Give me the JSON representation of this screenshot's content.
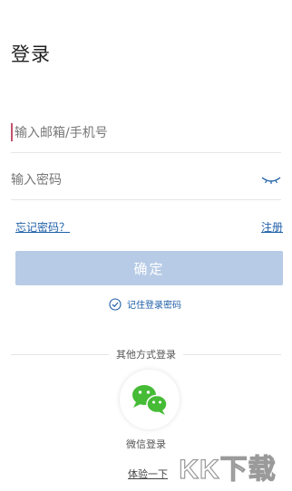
{
  "header": {
    "title": "登录"
  },
  "form": {
    "account_placeholder": "输入邮箱/手机号",
    "account_value": "",
    "password_placeholder": "输入密码",
    "password_value": "",
    "forgot_password": "忘记密码？",
    "register": "注册",
    "confirm": "确定",
    "remember_password": "记住登录密码"
  },
  "other_login": {
    "divider_text": "其他方式登录",
    "wechat_label": "微信登录",
    "try_label": "体验一下"
  },
  "watermark": {
    "text": "KK下载"
  },
  "colors": {
    "accent": "#1f5fa8",
    "button_bg": "#b7cbe6",
    "wechat_green": "#46bb36",
    "cursor": "#c2536c"
  },
  "icons": {
    "password_toggle": "eye-closed-icon",
    "remember_check": "check-circle-icon",
    "wechat": "wechat-icon"
  }
}
